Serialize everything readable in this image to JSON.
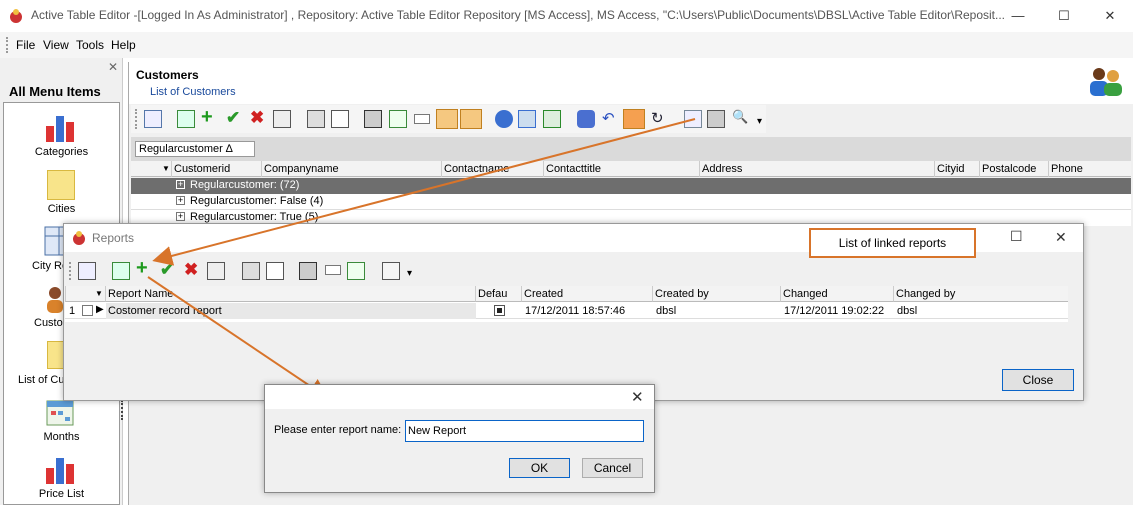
{
  "window": {
    "title": "Active Table Editor -[Logged In As Administrator] , Repository: Active Table Editor Repository  [MS Access], MS Access, \"C:\\Users\\Public\\Documents\\DBSL\\Active Table Editor\\Reposit...",
    "minimize": "—",
    "maximize": "☐",
    "close": "✕"
  },
  "menu": [
    "File",
    "View",
    "Tools",
    "Help"
  ],
  "left_panel": {
    "title": "All Menu Items",
    "close": "✕",
    "items": [
      "Categories",
      "Cities",
      "City Re",
      "Custo",
      "List of Cu",
      "Months",
      "Price List"
    ]
  },
  "customers": {
    "title": "Customers",
    "subtitle": "List of Customers"
  },
  "group_by": "Regularcustomer  ∆",
  "grid": {
    "columns": [
      "Customerid",
      "Companyname",
      "Contactname",
      "Contacttitle",
      "Address",
      "Cityid",
      "Postalcode",
      "Phone"
    ],
    "rows": [
      "Regularcustomer: (72)",
      "Regularcustomer: False (4)",
      "Regularcustomer: True (5)"
    ]
  },
  "reports": {
    "title": "Reports",
    "callout": "List of linked reports",
    "columns": [
      "Report Name",
      "Defau",
      "Created",
      "Created by",
      "Changed",
      "Changed by"
    ],
    "row": {
      "index": "1",
      "name": "Costomer record report",
      "created": "17/12/2011 18:57:46",
      "created_by": "dbsl",
      "changed": "17/12/2011 19:02:22",
      "changed_by": "dbsl"
    },
    "close_label": "Close"
  },
  "dialog": {
    "label": "Please enter report name:",
    "value": "New Report",
    "ok": "OK",
    "cancel": "Cancel",
    "close": "✕"
  },
  "colors": {
    "accent": "#d8742a",
    "focus": "#0a64c8"
  }
}
